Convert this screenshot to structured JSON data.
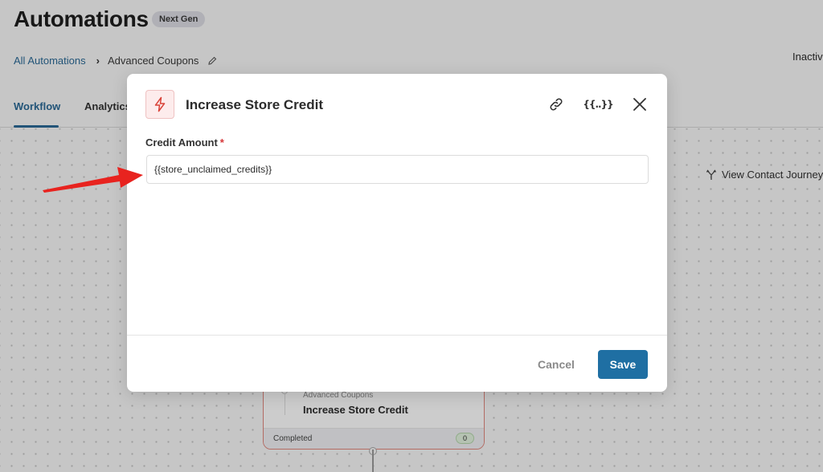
{
  "header": {
    "title": "Automations",
    "badge": "Next Gen",
    "breadcrumb": {
      "root": "All Automations",
      "current": "Advanced Coupons"
    },
    "status": "Inactiv"
  },
  "tabs": [
    {
      "label": "Workflow",
      "active": true
    },
    {
      "label": "Analytics",
      "active": false
    }
  ],
  "canvas": {
    "view_journey_label": "View Contact Journey",
    "node": {
      "subtitle": "Advanced Coupons",
      "title": "Increase Store Credit",
      "footer_label": "Completed",
      "count": "0"
    }
  },
  "modal": {
    "icon": "bolt-icon",
    "title": "Increase Store Credit",
    "header_actions": [
      "link-icon",
      "merge-tags-icon",
      "close-icon"
    ],
    "merge_tag_glyph": "{{..}}",
    "field": {
      "label": "Credit Amount",
      "required_marker": "*",
      "value": "{{store_unclaimed_credits}}"
    },
    "cancel_label": "Cancel",
    "save_label": "Save",
    "colors": {
      "save": "#1f6fa3",
      "accent": "#2b6a96",
      "annotation_arrow": "#e8231f"
    }
  }
}
